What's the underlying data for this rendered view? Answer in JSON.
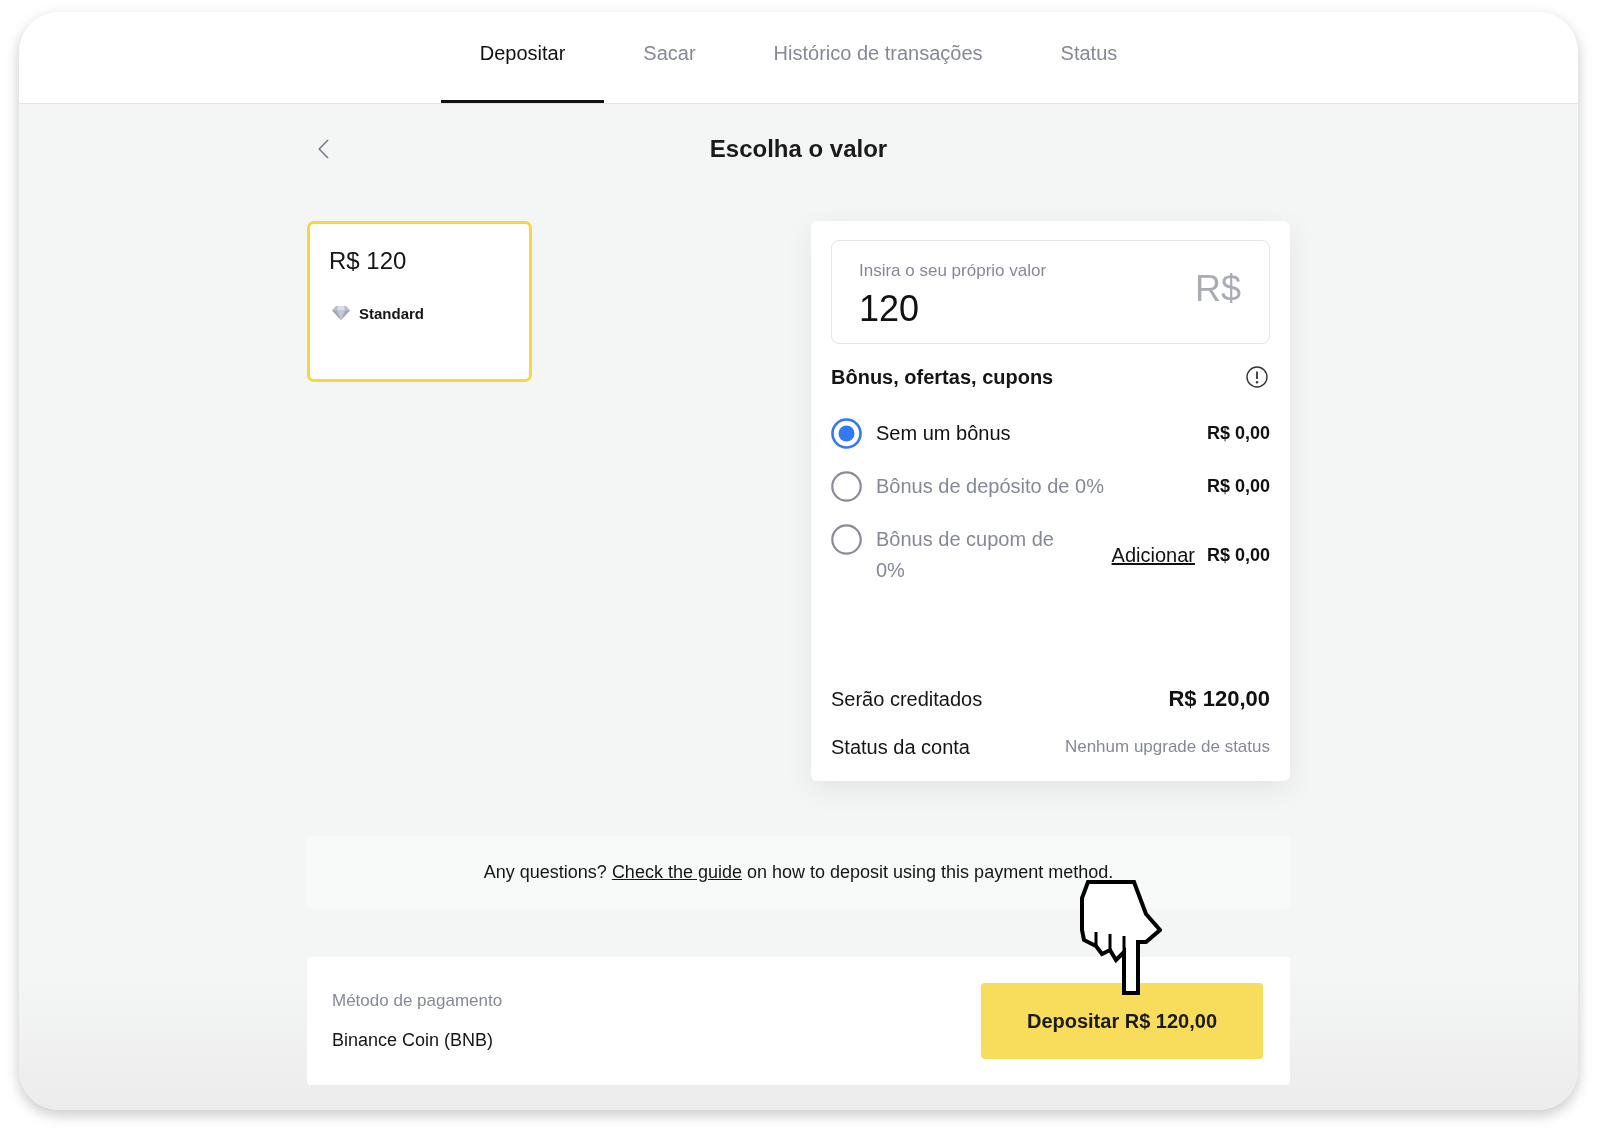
{
  "tabs": [
    {
      "label": "Depositar",
      "selected": true
    },
    {
      "label": "Sacar",
      "selected": false
    },
    {
      "label": "Histórico de transações",
      "selected": false
    },
    {
      "label": "Status",
      "selected": false
    }
  ],
  "page_title": "Escolha o valor",
  "amount_cards": [
    {
      "amount": "R$ 120",
      "tier": "Standard",
      "selected": true
    }
  ],
  "amount_field": {
    "label": "Insira o seu próprio valor",
    "value": "120",
    "currency": "R$"
  },
  "bonuses": {
    "title": "Bônus, ofertas, cupons",
    "options": [
      {
        "label": "Sem um bônus",
        "amount": "R$ 0,00",
        "selected": true
      },
      {
        "label": "Bônus de depósito de 0%",
        "amount": "R$ 0,00",
        "selected": false
      },
      {
        "label": "Bônus de cupom de 0%",
        "link": "Adicionar",
        "amount": "R$ 0,00",
        "selected": false
      }
    ]
  },
  "summary": [
    {
      "label": "Serão creditados",
      "value": "R$ 120,00",
      "kind": "amount"
    },
    {
      "label": "Status da conta",
      "value": "Nenhum upgrade de status",
      "kind": "note"
    }
  ],
  "guide": {
    "text_before": "Any questions?",
    "link": "Check the guide",
    "text_after": "on how to deposit using this payment method."
  },
  "payment": {
    "label": "Método de pagamento",
    "method": "Binance Coin (BNB)",
    "button": "Depositar R$ 120,00"
  }
}
